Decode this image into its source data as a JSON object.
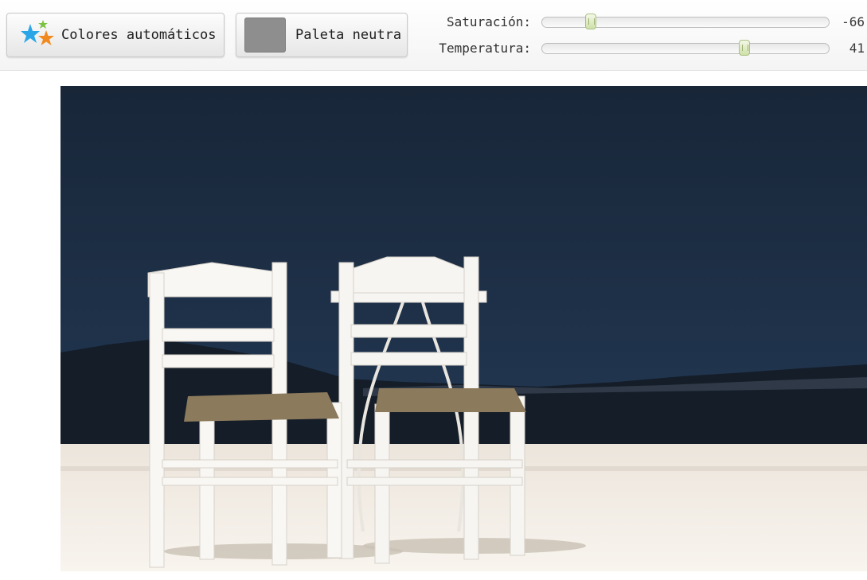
{
  "toolbar": {
    "auto_colors_label": "Colores automáticos",
    "neutral_palette_label": "Paleta neutra",
    "neutral_swatch_color": "#8e8e8e",
    "auto_colors_icon": "multicolor-stars-icon"
  },
  "sliders": [
    {
      "label": "Saturación:",
      "value": "-66",
      "fraction": 0.17
    },
    {
      "label": "Temperatura:",
      "value": "41",
      "fraction": 0.705
    }
  ],
  "photo": {
    "subject": "two-white-chairs-overlooking-sea",
    "sky_color": "#1b2b3f",
    "ground_color": "#f4efe7"
  }
}
